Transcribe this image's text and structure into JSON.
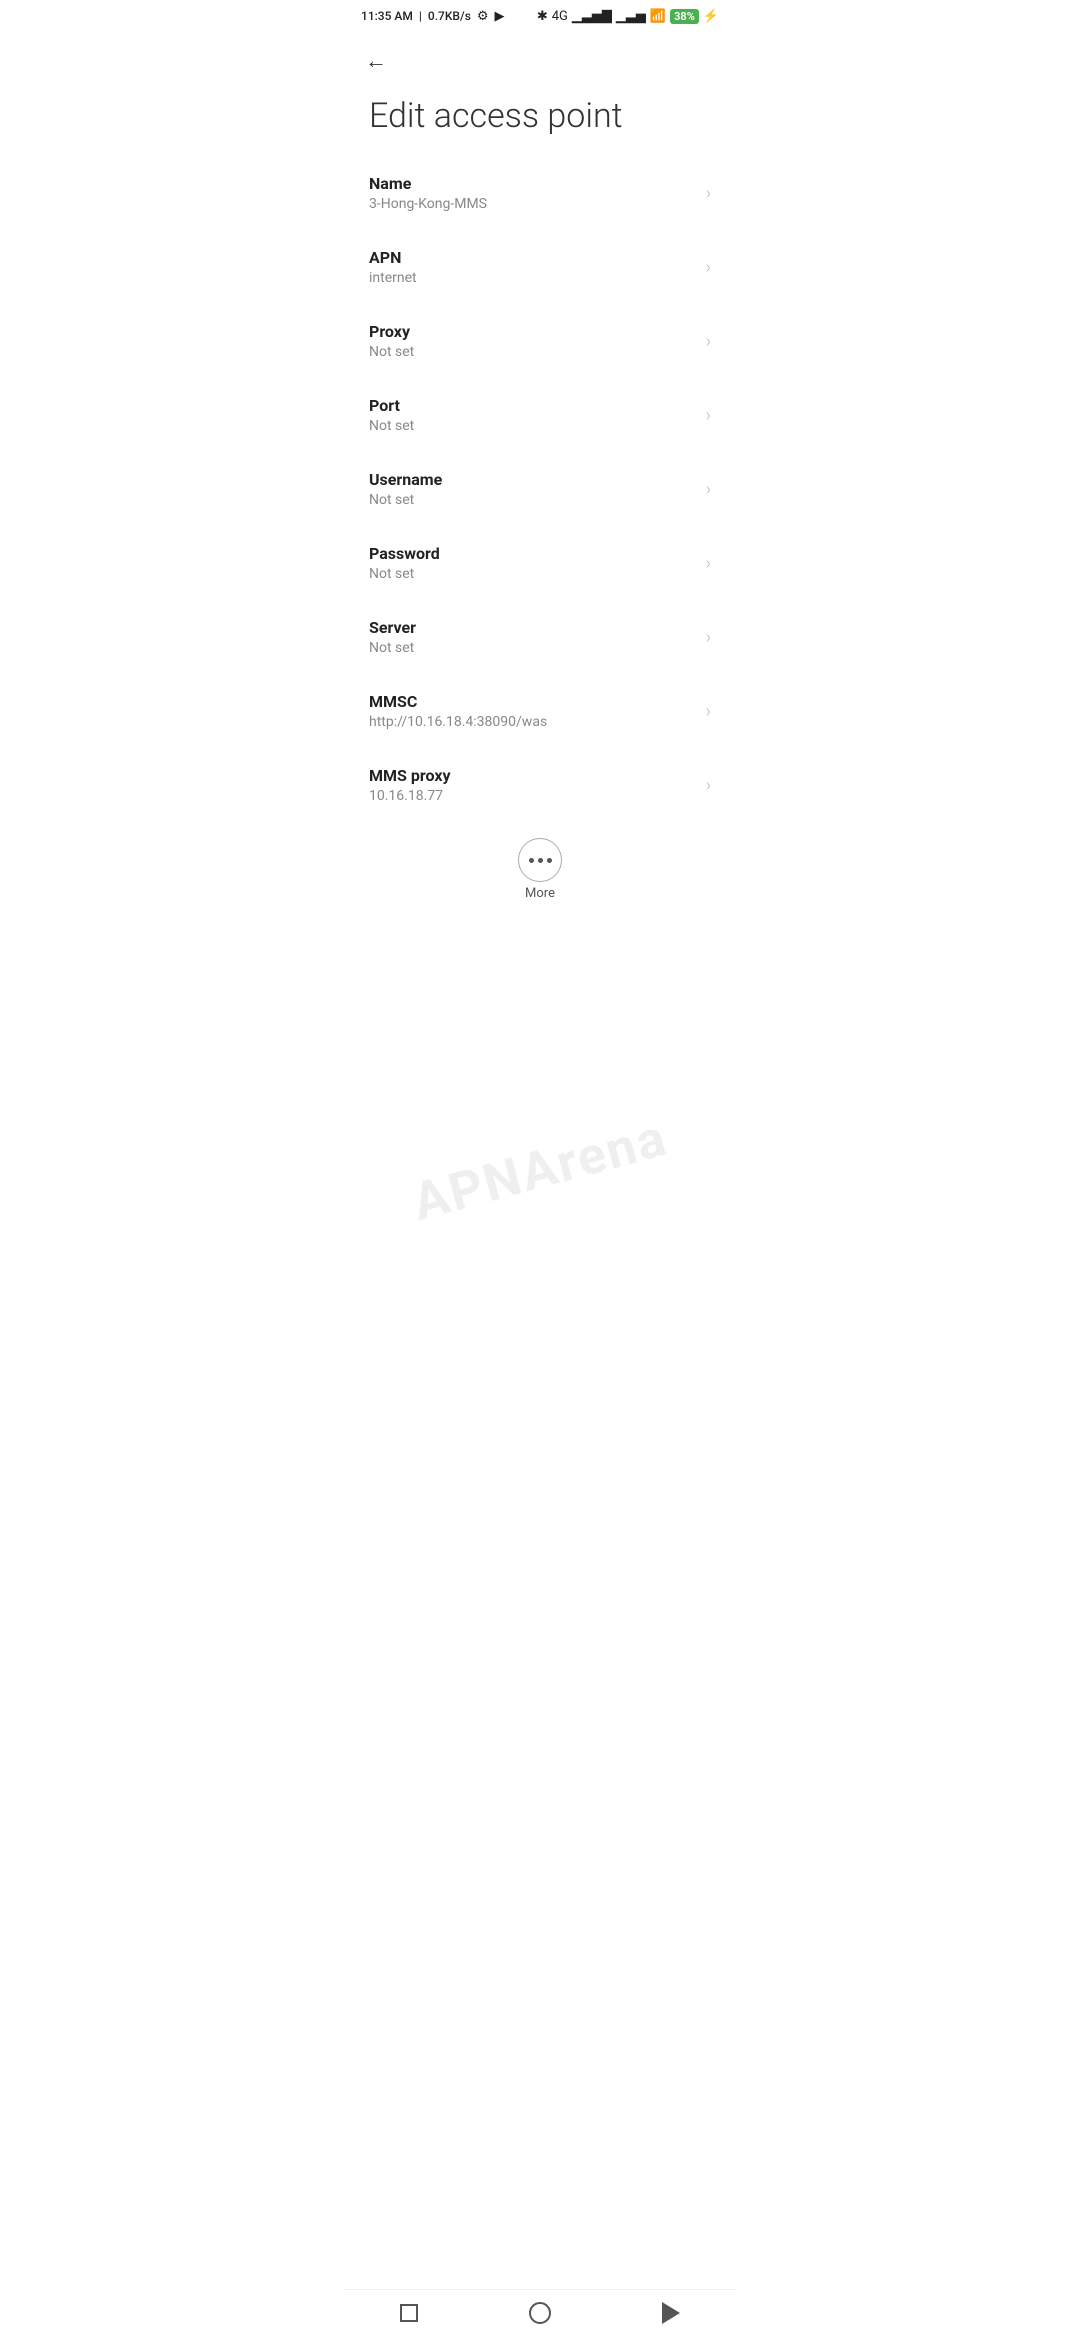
{
  "statusBar": {
    "time": "11:35 AM",
    "speed": "0.7KB/s",
    "battery": "38"
  },
  "toolbar": {
    "backLabel": "←"
  },
  "page": {
    "title": "Edit access point"
  },
  "settings": [
    {
      "label": "Name",
      "value": "3-Hong-Kong-MMS"
    },
    {
      "label": "APN",
      "value": "internet"
    },
    {
      "label": "Proxy",
      "value": "Not set"
    },
    {
      "label": "Port",
      "value": "Not set"
    },
    {
      "label": "Username",
      "value": "Not set"
    },
    {
      "label": "Password",
      "value": "Not set"
    },
    {
      "label": "Server",
      "value": "Not set"
    },
    {
      "label": "MMSC",
      "value": "http://10.16.18.4:38090/was"
    },
    {
      "label": "MMS proxy",
      "value": "10.16.18.77"
    }
  ],
  "more": {
    "label": "More"
  },
  "watermark": "APNArena"
}
